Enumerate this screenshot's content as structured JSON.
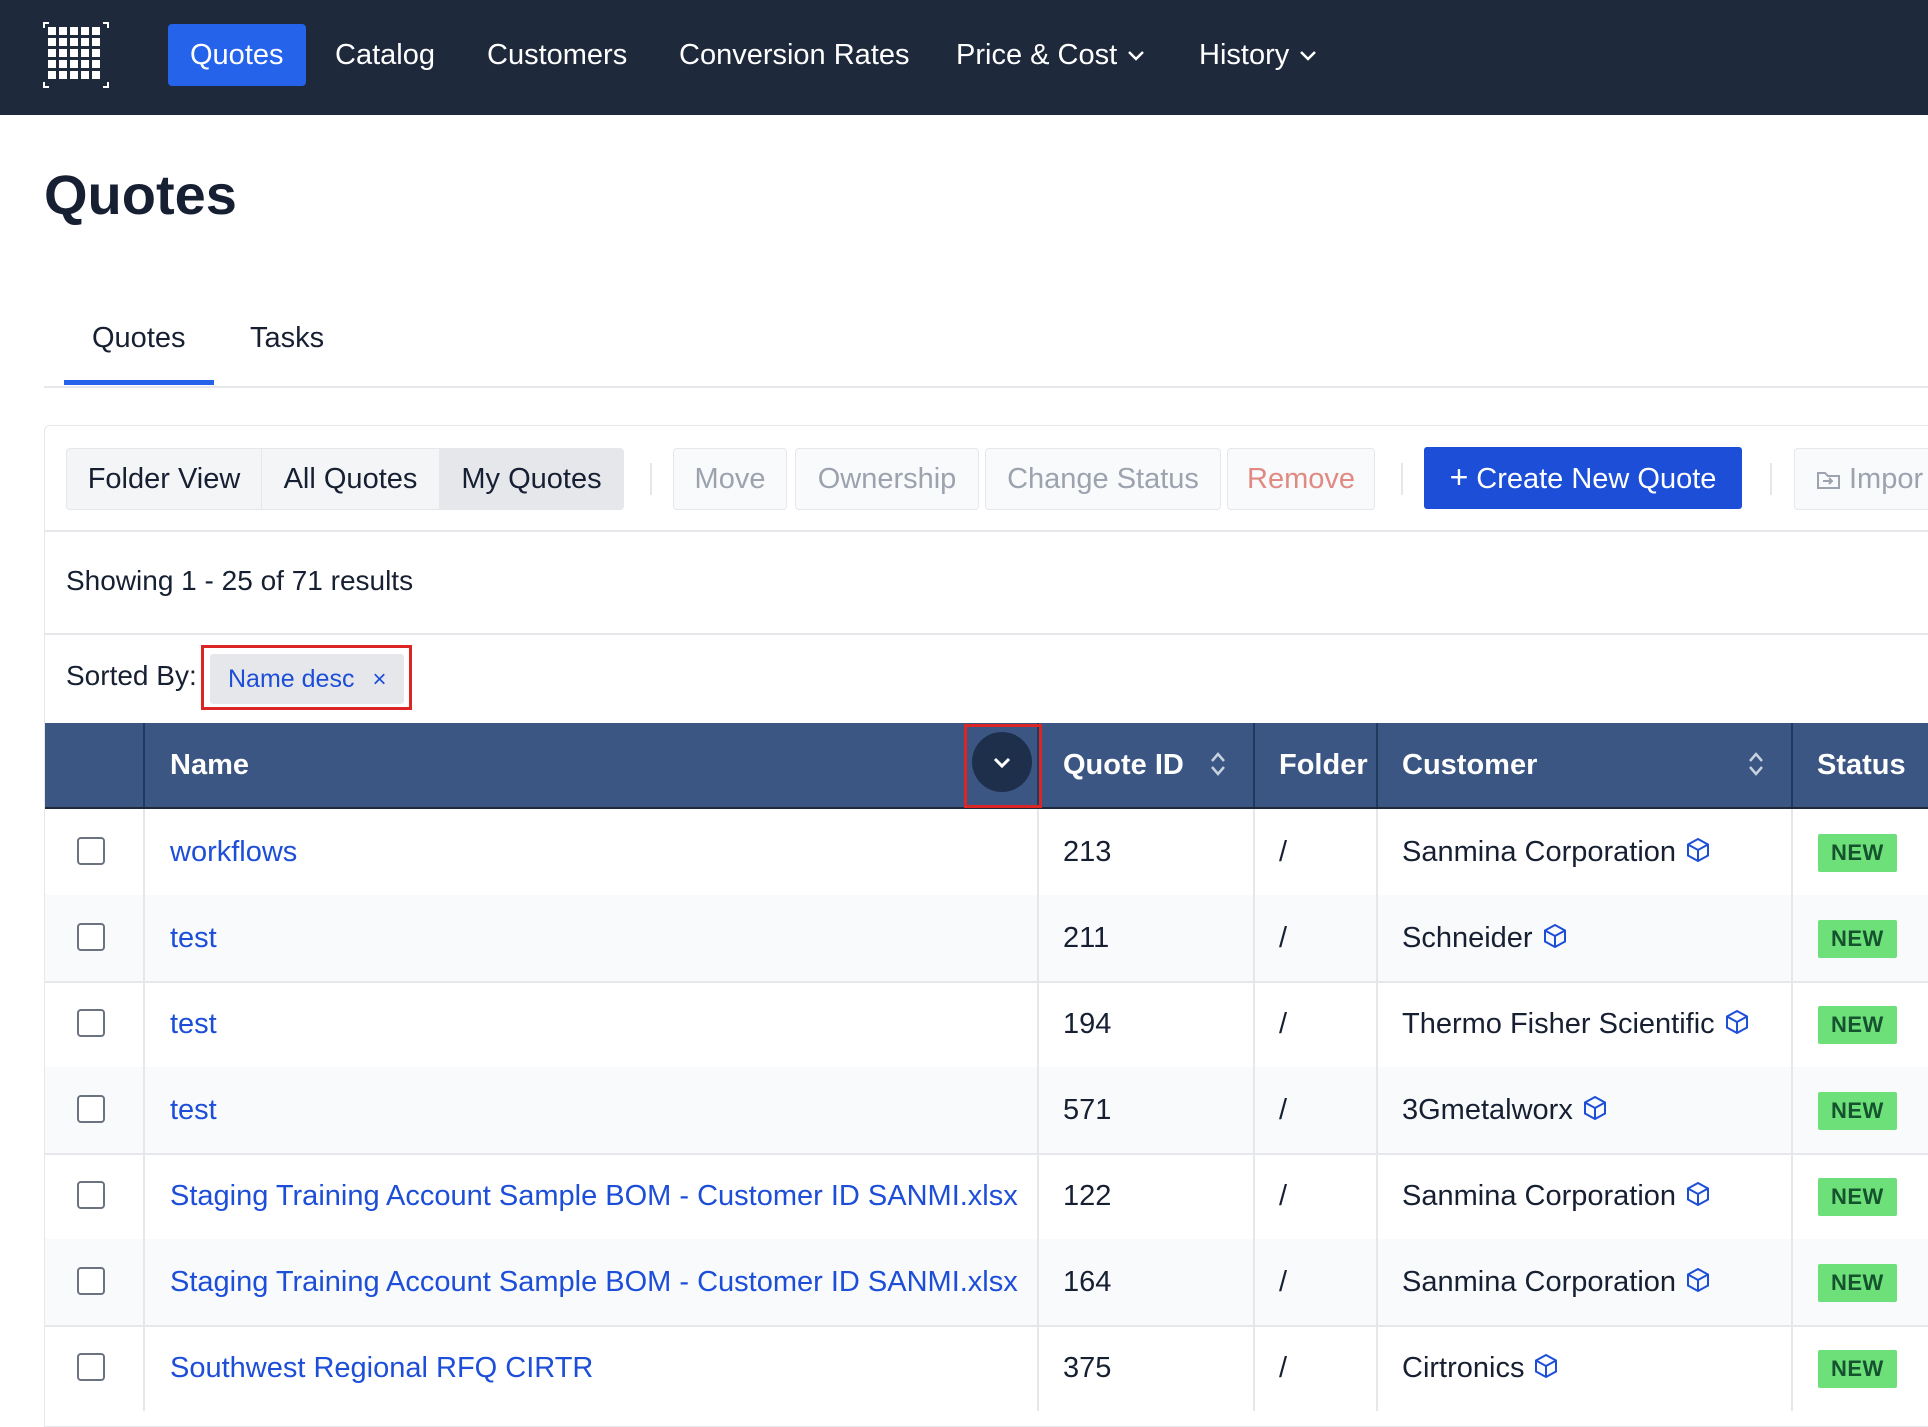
{
  "nav": {
    "items": [
      {
        "label": "Quotes",
        "active": true
      },
      {
        "label": "Catalog"
      },
      {
        "label": "Customers"
      },
      {
        "label": "Conversion Rates"
      },
      {
        "label": "Price & Cost",
        "dropdown": true
      },
      {
        "label": "History",
        "dropdown": true
      }
    ],
    "logo_icon": "grid-logo-icon"
  },
  "page": {
    "title": "Quotes",
    "tabs": [
      {
        "label": "Quotes",
        "active": true
      },
      {
        "label": "Tasks"
      }
    ]
  },
  "toolbar": {
    "view_segments": [
      "Folder View",
      "All Quotes",
      "My Quotes"
    ],
    "selected_segment": "My Quotes",
    "actions": [
      "Move",
      "Ownership",
      "Change Status",
      "Remove"
    ],
    "create_label": "Create New Quote",
    "create_icon": "plus-icon",
    "import_label": "Impor",
    "import_icon": "import-icon"
  },
  "results_text": "Showing 1 - 25 of 71 results",
  "sort": {
    "label": "Sorted By:",
    "chip": "Name desc",
    "chip_close": "×"
  },
  "table": {
    "columns": [
      "Name",
      "Quote ID",
      "Folder",
      "Customer",
      "Status"
    ],
    "rows": [
      {
        "name": "workflows",
        "quote_id": "213",
        "folder": "/",
        "customer": "Sanmina Corporation",
        "status": "NEW"
      },
      {
        "name": "test",
        "quote_id": "211",
        "folder": "/",
        "customer": "Schneider",
        "status": "NEW"
      },
      {
        "name": "test",
        "quote_id": "194",
        "folder": "/",
        "customer": "Thermo Fisher Scientific",
        "status": "NEW"
      },
      {
        "name": "test",
        "quote_id": "571",
        "folder": "/",
        "customer": "3Gmetalworx",
        "status": "NEW"
      },
      {
        "name": "Staging Training Account Sample BOM - Customer ID SANMI.xlsx",
        "quote_id": "122",
        "folder": "/",
        "customer": "Sanmina Corporation",
        "status": "NEW"
      },
      {
        "name": "Staging Training Account Sample BOM - Customer ID SANMI.xlsx",
        "quote_id": "164",
        "folder": "/",
        "customer": "Sanmina Corporation",
        "status": "NEW"
      },
      {
        "name": "Southwest Regional RFQ CIRTR",
        "quote_id": "375",
        "folder": "/",
        "customer": "Cirtronics",
        "status": "NEW"
      }
    ]
  },
  "colors": {
    "nav_bg": "#1e293b",
    "accent": "#2563eb",
    "table_header": "#3b5682",
    "status_new": "#6ee07a",
    "highlight": "#dc2626"
  }
}
